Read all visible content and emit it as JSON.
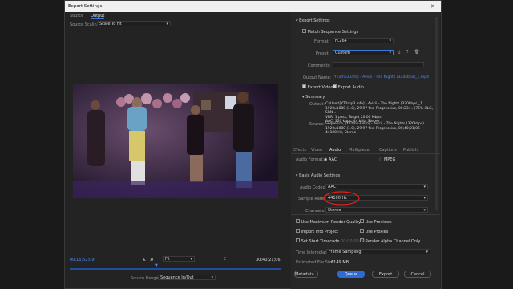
{
  "window": {
    "title": "Export Settings",
    "close": "✕"
  },
  "left_tabs": {
    "source": "Source",
    "output": "Output"
  },
  "source_scaling": {
    "label": "Source Scaling",
    "value": "Scale To Fit"
  },
  "timeline": {
    "in_time": "00;16;52;09",
    "out_time": "00;40;21;06",
    "fit": "Fit",
    "source_range_label": "Source Range:",
    "source_range_value": "Sequence In/Out"
  },
  "export_settings": {
    "header": "Export Settings",
    "match_sequence": "Match Sequence Settings",
    "format_label": "Format:",
    "format_value": "H.264",
    "preset_label": "Preset:",
    "preset_value": "Custom",
    "comments_label": "Comments:",
    "output_name_label": "Output Name:",
    "output_name_value": "[YT2mp3.info] - Avicii - The Nights (320kbps)_1.mp4",
    "export_video": "Export Video",
    "export_audio": "Export Audio"
  },
  "summary": {
    "header": "Summary",
    "output_label": "Output:",
    "output_lines": [
      "C:\\User\\[YT2mp3.info] - Avicii - The Nights (320kbps)_1...",
      "1920x1080 (1.0), 29.97 fps, Progressive, 00:23:... (75% HLG, SRN...",
      "VBR, 1 pass, Target 20.00 Mbps",
      "AAC, 320 kbps, 44 kHz, Stereo"
    ],
    "source_label": "Source:",
    "source_lines": [
      "Sequence, [YT2mp3.info] - Avicii - The Nights (320kbps)",
      "1920x1080 (1.0), 29.97 fps, Progressive, 00;40;21;06",
      "44100 Hz, Stereo"
    ]
  },
  "right_tabs": [
    "Effects",
    "Video",
    "Audio",
    "Multiplexer",
    "Captions",
    "Publish"
  ],
  "audio_format": {
    "label": "Audio Format:",
    "aac": "AAC",
    "mpeg": "MPEG"
  },
  "basic_audio": {
    "header": "Basic Audio Settings",
    "codec_label": "Audio Codec:",
    "codec_value": "AAC",
    "sample_rate_label": "Sample Rate:",
    "sample_rate_value": "44100 Hz",
    "channels_label": "Channels:",
    "channels_value": "Stereo"
  },
  "options": {
    "use_max_render": "Use Maximum Render Quality",
    "use_previews": "Use Previews",
    "import_into_project": "Import Into Project",
    "use_proxies": "Use Proxies",
    "set_start_timecode": "Set Start Timecode",
    "start_timecode_value": "00;00;00;00",
    "render_alpha": "Render Alpha Channel Only",
    "time_interp_label": "Time Interpolation:",
    "time_interp_value": "Frame Sampling",
    "file_size_label": "Estimated File Size:",
    "file_size_value": "6149 MB"
  },
  "buttons": {
    "metadata": "Metadata...",
    "queue": "Queue",
    "export": "Export",
    "cancel": "Cancel"
  },
  "colors": {
    "accent": "#2f6cd1",
    "link": "#4c8dff",
    "annotation": "#e0201e"
  }
}
